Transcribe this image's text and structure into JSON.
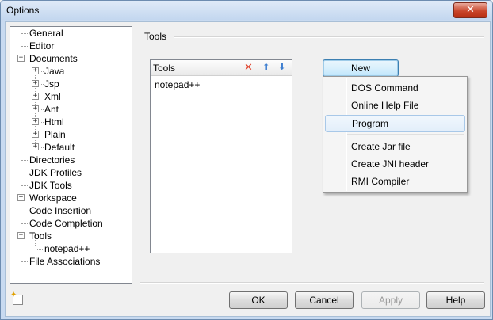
{
  "window": {
    "title": "Options",
    "close_glyph": "✕"
  },
  "tree": {
    "items": [
      {
        "label": "General",
        "expander": ""
      },
      {
        "label": "Editor",
        "expander": ""
      },
      {
        "label": "Documents",
        "expander": "−"
      },
      {
        "label": "Java",
        "expander": "+"
      },
      {
        "label": "Jsp",
        "expander": "+"
      },
      {
        "label": "Xml",
        "expander": "+"
      },
      {
        "label": "Ant",
        "expander": "+"
      },
      {
        "label": "Html",
        "expander": "+"
      },
      {
        "label": "Plain",
        "expander": "+"
      },
      {
        "label": "Default",
        "expander": "+"
      },
      {
        "label": "Directories",
        "expander": ""
      },
      {
        "label": "JDK Profiles",
        "expander": ""
      },
      {
        "label": "JDK Tools",
        "expander": ""
      },
      {
        "label": "Workspace",
        "expander": "+"
      },
      {
        "label": "Code Insertion",
        "expander": ""
      },
      {
        "label": "Code Completion",
        "expander": ""
      },
      {
        "label": "Tools",
        "expander": "−"
      },
      {
        "label": "notepad++",
        "expander": ""
      },
      {
        "label": "File Associations",
        "expander": ""
      }
    ]
  },
  "section": {
    "title": "Tools"
  },
  "tools_panel": {
    "header": "Tools",
    "icons": {
      "delete": "✕",
      "up": "⬆",
      "down": "⬇"
    },
    "entries": [
      "notepad++"
    ]
  },
  "new_button": {
    "label": "New"
  },
  "new_menu": {
    "items": [
      "DOS Command",
      "Online Help File",
      "Program",
      "Create Jar file",
      "Create JNI header",
      "RMI Compiler"
    ],
    "hovered": "Program"
  },
  "buttons": {
    "ok": "OK",
    "cancel": "Cancel",
    "apply": "Apply",
    "help": "Help"
  },
  "icons": [
    "close-icon",
    "delete-icon",
    "move-up-icon",
    "move-down-icon",
    "new-item-icon"
  ],
  "colors": {
    "delete_icon": "#e0452f",
    "arrow_icon": "#3f7fd0",
    "menu_hover": "#e2eefa"
  }
}
